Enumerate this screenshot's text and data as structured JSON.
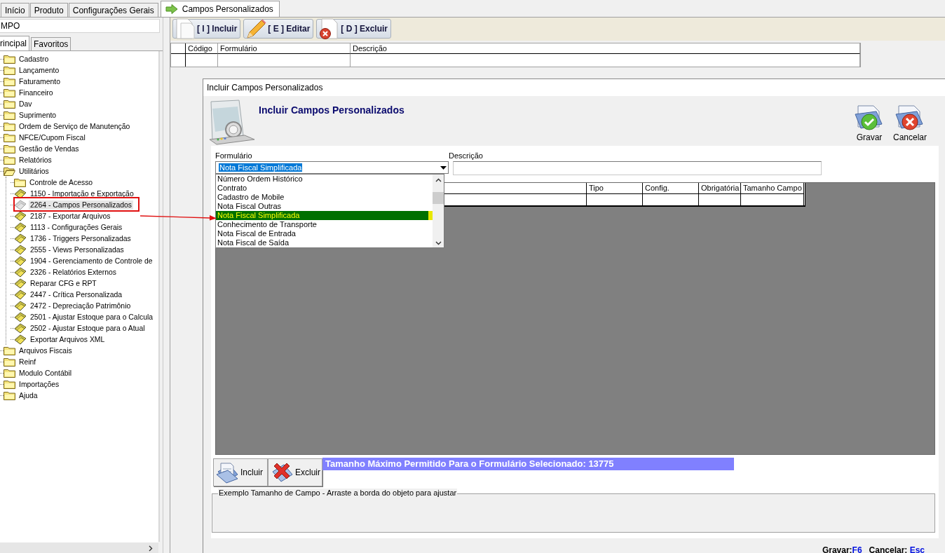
{
  "top_tabs": [
    {
      "label": "Início",
      "selected": false
    },
    {
      "label": "Produto",
      "selected": false
    },
    {
      "label": "Configurações Gerais",
      "selected": false
    },
    {
      "label": "Campos Personalizados",
      "selected": true
    }
  ],
  "sidebar": {
    "search_value": "MPO",
    "tabs": [
      {
        "label": "rincipal",
        "selected": true
      },
      {
        "label": "Favoritos",
        "selected": false
      }
    ],
    "tree": [
      {
        "label": "Cadastro",
        "expanded": false,
        "selected": false
      },
      {
        "label": "Lançamento",
        "expanded": false,
        "selected": false
      },
      {
        "label": "Faturamento",
        "expanded": false,
        "selected": false
      },
      {
        "label": "Financeiro",
        "expanded": false,
        "selected": false
      },
      {
        "label": "Dav",
        "expanded": false,
        "selected": false
      },
      {
        "label": "Suprimento",
        "expanded": false,
        "selected": false
      },
      {
        "label": "Ordem de Serviço de Manutenção",
        "expanded": false,
        "selected": false
      },
      {
        "label": "NFCE/Cupom Fiscal",
        "expanded": false,
        "selected": false
      },
      {
        "label": "Gestão de Vendas",
        "expanded": false,
        "selected": false
      },
      {
        "label": "Relatórios",
        "expanded": false,
        "selected": false
      },
      {
        "label": "Utilitários",
        "expanded": true,
        "selected": false,
        "children": [
          {
            "label": "Controle de Acesso",
            "kind": "folder",
            "selected": false
          },
          {
            "label": "1150 - Importação e Exportação",
            "kind": "program",
            "selected": false
          },
          {
            "label": "2264 - Campos Personalizados",
            "kind": "program",
            "selected": true
          },
          {
            "label": "2187 - Exportar Arquivos",
            "kind": "program",
            "selected": false
          },
          {
            "label": "1113 - Configurações Gerais",
            "kind": "program",
            "selected": false
          },
          {
            "label": "1736 - Triggers Personalizadas",
            "kind": "program",
            "selected": false
          },
          {
            "label": "2555 - Views Personalizadas",
            "kind": "program",
            "selected": false
          },
          {
            "label": "1904 - Gerenciamento de Controle de",
            "kind": "program",
            "selected": false
          },
          {
            "label": "2326 - Relatórios Externos",
            "kind": "program",
            "selected": false
          },
          {
            "label": "Reparar CFG e RPT",
            "kind": "program",
            "selected": false
          },
          {
            "label": "2447 - Crítica Personalizada",
            "kind": "program",
            "selected": false
          },
          {
            "label": "2472 - Depreciação Patrimônio",
            "kind": "program",
            "selected": false
          },
          {
            "label": "2501 - Ajustar Estoque para o Calcula",
            "kind": "program",
            "selected": false
          },
          {
            "label": "2502 - Ajustar Estoque para o Atual",
            "kind": "program",
            "selected": false
          },
          {
            "label": "Exportar Arquivos XML",
            "kind": "program",
            "selected": false
          }
        ]
      },
      {
        "label": "Arquivos Fiscais",
        "expanded": false,
        "selected": false
      },
      {
        "label": "Reinf",
        "expanded": false,
        "selected": false
      },
      {
        "label": "Modulo Contábil",
        "expanded": false,
        "selected": false
      },
      {
        "label": "Importações",
        "expanded": false,
        "selected": false
      },
      {
        "label": "Ajuda",
        "expanded": false,
        "selected": false
      }
    ]
  },
  "toolbar": [
    {
      "label": "[ I ] Incluir",
      "kind": "new"
    },
    {
      "label": "[ E ] Editar",
      "kind": "edit"
    },
    {
      "label": "[ D ] Excluir",
      "kind": "delete"
    }
  ],
  "list_table": {
    "columns": [
      "Código",
      "Formulário",
      "Descrição"
    ]
  },
  "dialog": {
    "window_title": "Incluir Campos Personalizados",
    "heading": "Incluir Campos Personalizados",
    "actions": [
      {
        "label": "Gravar",
        "kind": "save"
      },
      {
        "label": "Cancelar",
        "kind": "cancel"
      }
    ],
    "form_label": "Formulário",
    "form_value": "Nota Fiscal Simplificada",
    "description_label": "Descrição",
    "dropdown_options": [
      {
        "label": "Número Ordem Histórico",
        "selected": false
      },
      {
        "label": "Contrato",
        "selected": false
      },
      {
        "label": "Cadastro de Mobile",
        "selected": false
      },
      {
        "label": "Nota Fiscal Outras",
        "selected": false
      },
      {
        "label": "Nota Fiscal Simplificada",
        "selected": true
      },
      {
        "label": "Conhecimento de Transporte",
        "selected": false
      },
      {
        "label": "Nota Fiscal de Entrada",
        "selected": false
      },
      {
        "label": "Nota Fiscal de Saída",
        "selected": false
      }
    ],
    "fields_table": {
      "columns": [
        "Tipo",
        "Config.",
        "Obrigatória",
        "Tamanho Campo"
      ]
    },
    "row_buttons": [
      {
        "label": "Incluir",
        "kind": "add"
      },
      {
        "label": "Excluir",
        "kind": "delete"
      }
    ],
    "max_size_notice": "Tamanho Máximo Permitido Para o Formulário Selecionado: 13775",
    "sample_group_title": "Exemplo Tamanho de Campo - Arraste a borda do objeto para ajustar",
    "shortcuts": [
      {
        "label": "Gravar:",
        "key": "F6"
      },
      {
        "label": "Cancelar: ",
        "key": "Esc"
      }
    ]
  }
}
